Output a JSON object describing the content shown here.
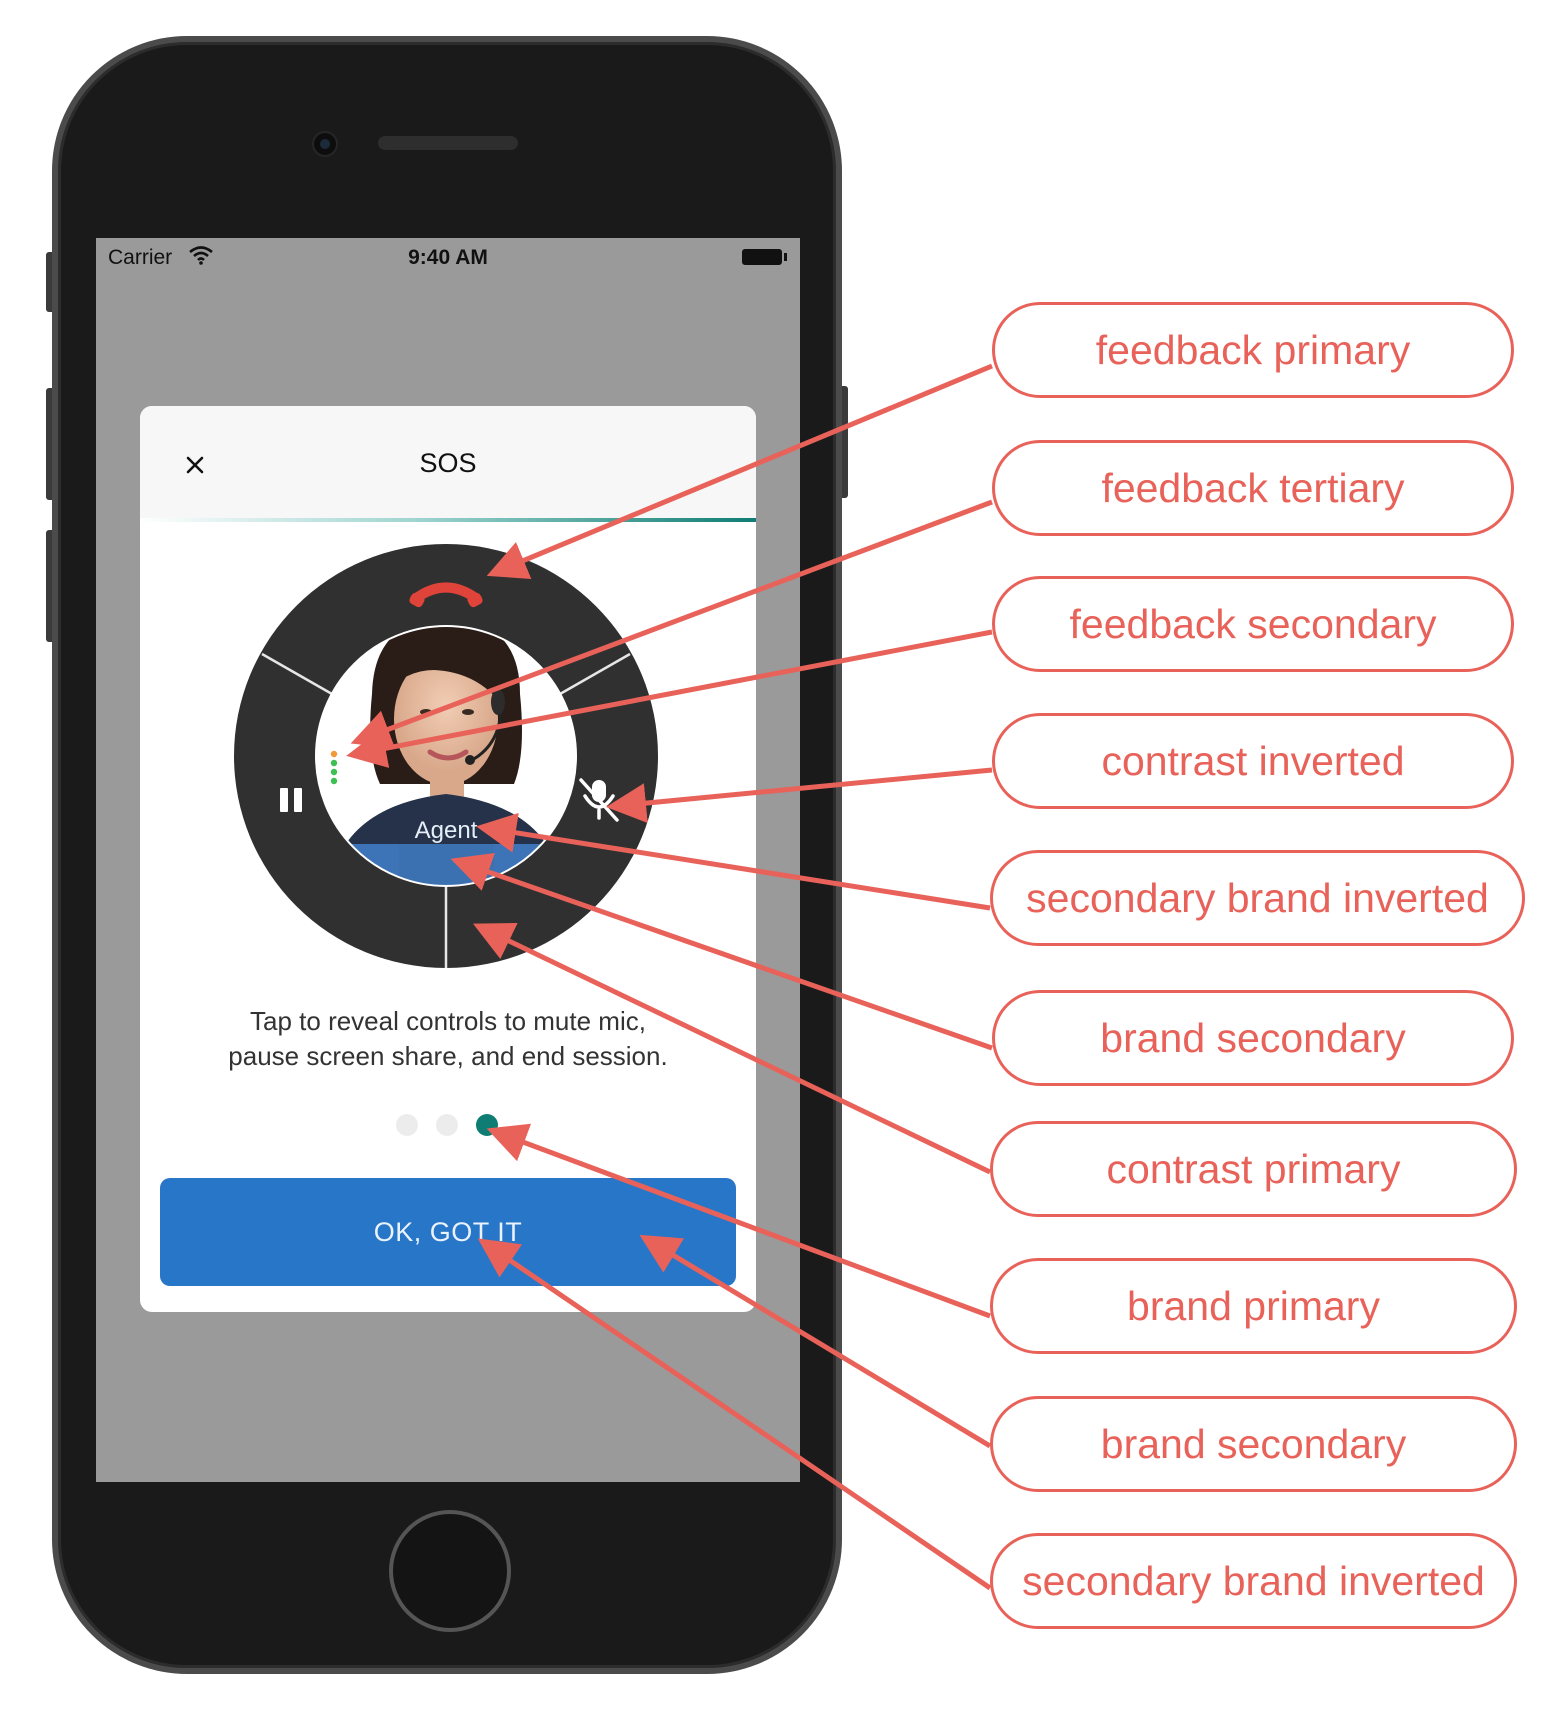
{
  "status_bar": {
    "carrier": "Carrier",
    "time": "9:40 AM"
  },
  "modal": {
    "title": "SOS",
    "agent_label": "Agent",
    "instruction_line1": "Tap to reveal controls to mute mic,",
    "instruction_line2": "pause screen share, and end session.",
    "page_dots": {
      "count": 3,
      "active_index": 2
    },
    "ok_button": "OK, GOT IT"
  },
  "callouts": [
    {
      "label": "feedback primary"
    },
    {
      "label": "feedback tertiary"
    },
    {
      "label": "feedback secondary"
    },
    {
      "label": "contrast inverted"
    },
    {
      "label": "secondary brand inverted"
    },
    {
      "label": "brand secondary"
    },
    {
      "label": "contrast primary"
    },
    {
      "label": "brand primary"
    },
    {
      "label": "brand secondary"
    },
    {
      "label": "secondary brand inverted"
    }
  ],
  "colors": {
    "annotation": "#e8625a",
    "brand_primary": "#0f7d73",
    "brand_secondary": "#2876c8",
    "feedback_primary": "#e0433a",
    "contrast_primary": "#333333"
  }
}
